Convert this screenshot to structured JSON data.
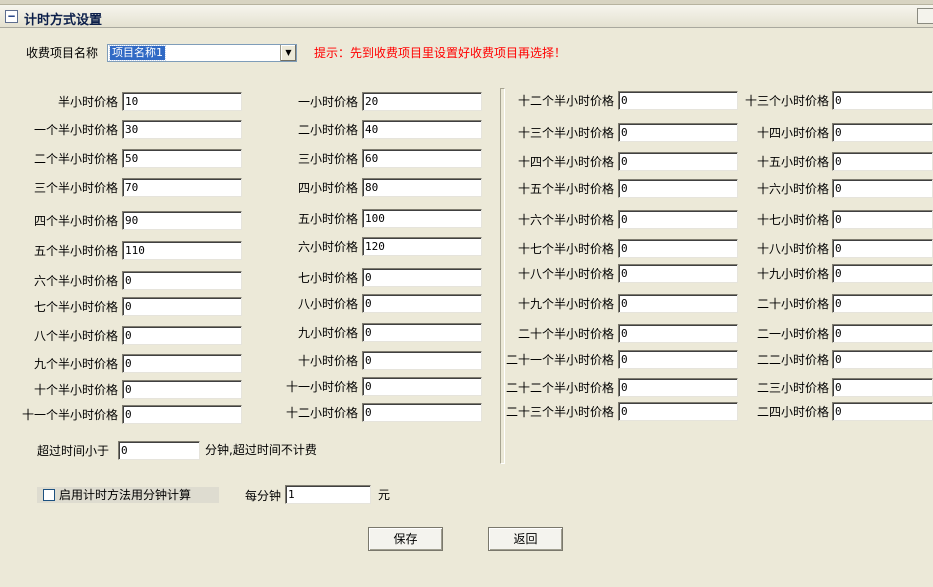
{
  "window": {
    "title": "计时方式设置",
    "collapse_glyph": "−"
  },
  "header": {
    "item_label": "收费项目名称",
    "item_value": "项目名称1",
    "hint": "提示：先到收费项目里设置好收费项目再选择！"
  },
  "price_label_suffix": "价格",
  "prices": [
    {
      "label": "半小时价格",
      "value": "10"
    },
    {
      "label": "一个半小时价格",
      "value": "30"
    },
    {
      "label": "二个半小时价格",
      "value": "50"
    },
    {
      "label": "三个半小时价格",
      "value": "70"
    },
    {
      "label": "四个半小时价格",
      "value": "90"
    },
    {
      "label": "五个半小时价格",
      "value": "110"
    },
    {
      "label": "六个半小时价格",
      "value": "0"
    },
    {
      "label": "七个半小时价格",
      "value": "0"
    },
    {
      "label": "八个半小时价格",
      "value": "0"
    },
    {
      "label": "九个半小时价格",
      "value": "0"
    },
    {
      "label": "十个半小时价格",
      "value": "0"
    },
    {
      "label": "十一个半小时价格",
      "value": "0"
    },
    {
      "label": "一小时价格",
      "value": "20"
    },
    {
      "label": "二小时价格",
      "value": "40"
    },
    {
      "label": "三小时价格",
      "value": "60"
    },
    {
      "label": "四小时价格",
      "value": "80"
    },
    {
      "label": "五小时价格",
      "value": "100"
    },
    {
      "label": "六小时价格",
      "value": "120"
    },
    {
      "label": "七小时价格",
      "value": "0"
    },
    {
      "label": "八小时价格",
      "value": "0"
    },
    {
      "label": "九小时价格",
      "value": "0"
    },
    {
      "label": "十小时价格",
      "value": "0"
    },
    {
      "label": "十一小时价格",
      "value": "0"
    },
    {
      "label": "十二小时价格",
      "value": "0"
    },
    {
      "label": "十二个半小时价格",
      "value": "0"
    },
    {
      "label": "十三个半小时价格",
      "value": "0"
    },
    {
      "label": "十四个半小时价格",
      "value": "0"
    },
    {
      "label": "十五个半小时价格",
      "value": "0"
    },
    {
      "label": "十六个半小时价格",
      "value": "0"
    },
    {
      "label": "十七个半小时价格",
      "value": "0"
    },
    {
      "label": "十八个半小时价格",
      "value": "0"
    },
    {
      "label": "十九个半小时价格",
      "value": "0"
    },
    {
      "label": "二十个半小时价格",
      "value": "0"
    },
    {
      "label": "二十一个半小时价格",
      "value": "0"
    },
    {
      "label": "二十二个半小时价格",
      "value": "0"
    },
    {
      "label": "二十三个半小时价格",
      "value": "0"
    },
    {
      "label": "十三个小时价格",
      "value": "0"
    },
    {
      "label": "十四小时价格",
      "value": "0"
    },
    {
      "label": "十五小时价格",
      "value": "0"
    },
    {
      "label": "十六小时价格",
      "value": "0"
    },
    {
      "label": "十七小时价格",
      "value": "0"
    },
    {
      "label": "十八小时价格",
      "value": "0"
    },
    {
      "label": "十九小时价格",
      "value": "0"
    },
    {
      "label": "二十小时价格",
      "value": "0"
    },
    {
      "label": "二一小时价格",
      "value": "0"
    },
    {
      "label": "二二小时价格",
      "value": "0"
    },
    {
      "label": "二三小时价格",
      "value": "0"
    },
    {
      "label": "二四小时价格",
      "value": "0"
    }
  ],
  "overtime": {
    "prefix": "超过时间小于",
    "value": "0",
    "suffix": "分钟,超过时间不计费"
  },
  "minute_mode": {
    "checkbox_label": "启用计时方法用分钟计算",
    "checked": false,
    "per_minute_label": "每分钟",
    "per_minute_value": "1",
    "unit": "元"
  },
  "buttons": {
    "save": "保存",
    "back": "返回"
  }
}
